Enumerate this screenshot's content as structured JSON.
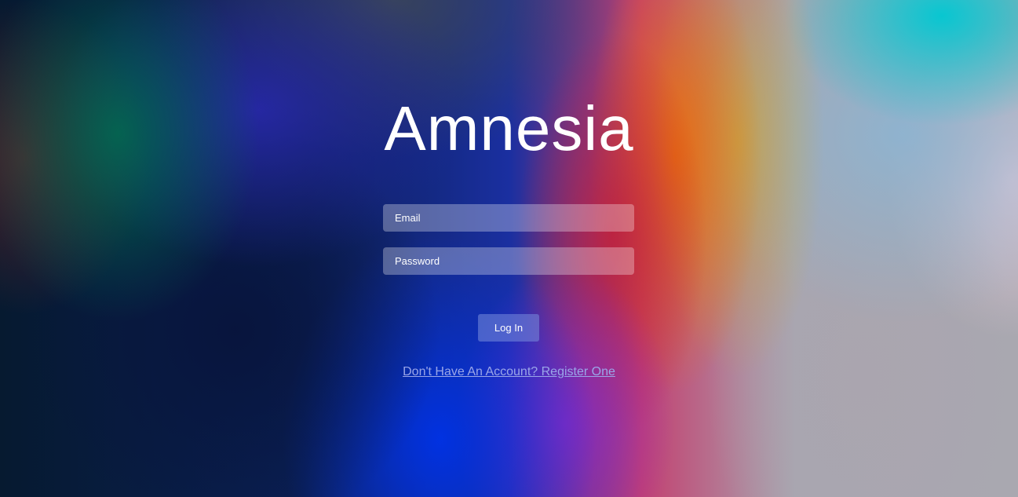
{
  "app": {
    "title": "Amnesia"
  },
  "form": {
    "email": {
      "value": "",
      "placeholder": "Email"
    },
    "password": {
      "value": "",
      "placeholder": "Password"
    },
    "login_label": "Log In",
    "register_link": "Don't Have An Account? Register One"
  },
  "colors": {
    "text": "#ffffff",
    "link": "#9aa6e8",
    "button_bg": "#7b8cdc",
    "field_bg": "#ffffff4d"
  }
}
